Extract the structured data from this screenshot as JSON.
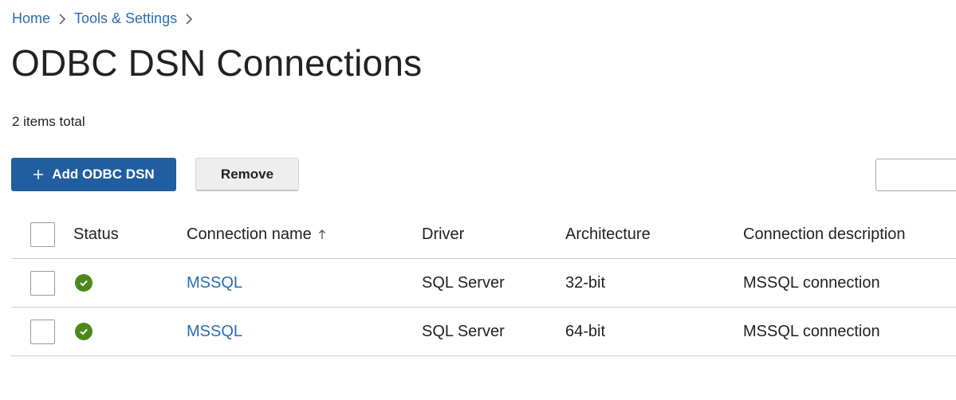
{
  "breadcrumb": {
    "items": [
      "Home",
      "Tools & Settings"
    ]
  },
  "page": {
    "title": "ODBC DSN Connections",
    "items_total": "2 items total"
  },
  "toolbar": {
    "add_label": "Add ODBC DSN",
    "remove_label": "Remove",
    "search_value": ""
  },
  "table": {
    "columns": [
      "Status",
      "Connection name",
      "Driver",
      "Architecture",
      "Connection description"
    ],
    "sort_column": "Connection name",
    "rows": [
      {
        "status": "ok",
        "name": "MSSQL",
        "driver": "SQL Server",
        "architecture": "32-bit",
        "description": "MSSQL connection"
      },
      {
        "status": "ok",
        "name": "MSSQL",
        "driver": "SQL Server",
        "architecture": "64-bit",
        "description": "MSSQL connection"
      }
    ]
  },
  "icons": {
    "breadcrumb_separator": "chevron-right-icon",
    "add": "plus-icon",
    "sort": "arrow-up-icon",
    "status_ok": "check-circle-icon"
  },
  "colors": {
    "primary": "#215ea0",
    "link": "#2b6cb0",
    "status_ok": "#4a8a1c"
  }
}
